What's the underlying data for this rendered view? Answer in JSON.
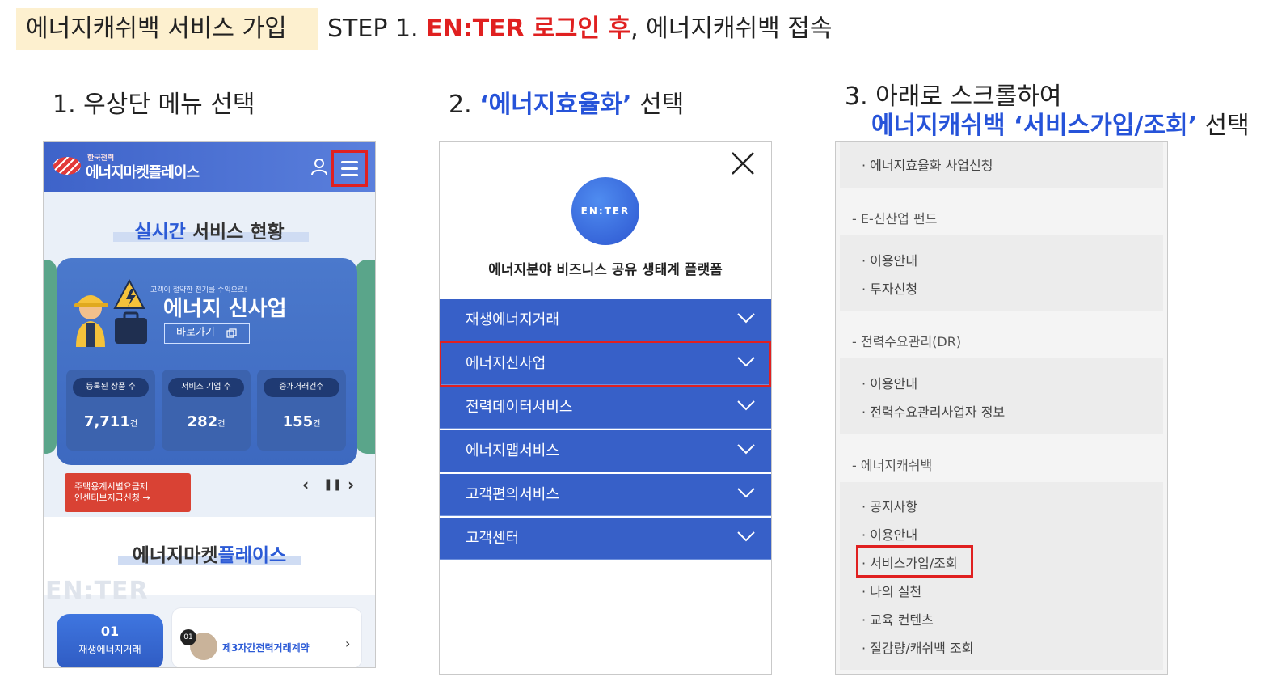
{
  "header": {
    "tag": "에너지캐쉬백 서비스 가입",
    "step_prefix": "STEP 1. ",
    "step_highlight": "EN:TER 로그인 후",
    "step_suffix": ", 에너지캐쉬백 접속"
  },
  "steps": {
    "s1": "1. 우상단 메뉴 선택",
    "s2_prefix": "2. ",
    "s2_highlight": "‘에너지효율화’",
    "s2_suffix": " 선택",
    "s3_line1": "3. 아래로 스크롤하여",
    "s3_highlight": "에너지캐쉬백 ‘서비스가입/조회’",
    "s3_suffix": " 선택"
  },
  "panel1": {
    "logo_sub": "한국전력",
    "logo_main": "에너지마켓플레이스",
    "section1_title_hl": "실시간",
    "section1_title": "서비스 현황",
    "card_small": "고객이 절약한 전기를 수익으로!",
    "card_big": "에너지 신사업",
    "card_button": "바로가기",
    "stats": [
      {
        "label": "등록된 상품 수",
        "value": "7,711",
        "unit": "건"
      },
      {
        "label": "서비스 기업 수",
        "value": "282",
        "unit": "건"
      },
      {
        "label": "중개거래건수",
        "value": "155",
        "unit": "건"
      }
    ],
    "banner_line1": "주택용계시별요금제",
    "banner_line2": "인센티브지급신청 →",
    "controls": {
      "prev": "‹",
      "pause": "❚❚",
      "next": "›"
    },
    "section2_title": "에너지마켓",
    "section2_title_hl": "플레이스",
    "watermark": "EN:TER",
    "tile_num": "01",
    "tile_label": "재생에너지거래",
    "card2_num": "01",
    "card2_title": "제3자간전력거래계약",
    "card2_chevron": "›"
  },
  "panel2": {
    "logo_text": "EN:TER",
    "tagline": "에너지분야 비즈니스 공유 생태계 플랫폼",
    "menu": [
      "재생에너지거래",
      "에너지신사업",
      "전력데이터서비스",
      "에너지맵서비스",
      "고객편의서비스",
      "고객센터"
    ]
  },
  "panel3": {
    "item_top": "· 에너지효율화 사업신청",
    "cat1": "- E-신산업 펀드",
    "cat1_items": [
      "· 이용안내",
      "· 투자신청"
    ],
    "cat2": "- 전력수요관리(DR)",
    "cat2_items": [
      "· 이용안내",
      "· 전력수요관리사업자 정보"
    ],
    "cat3": "- 에너지캐쉬백",
    "cat3_items": [
      "· 공지사항",
      "· 이용안내",
      "· 서비스가입/조회",
      "· 나의 실천",
      "· 교육 컨텐츠",
      "· 절감량/캐쉬백 조회"
    ]
  },
  "colors": {
    "accent_red": "#e02020",
    "accent_blue": "#2653d9",
    "menu_blue": "#3760c8",
    "tag_bg": "#fdf0cf"
  }
}
